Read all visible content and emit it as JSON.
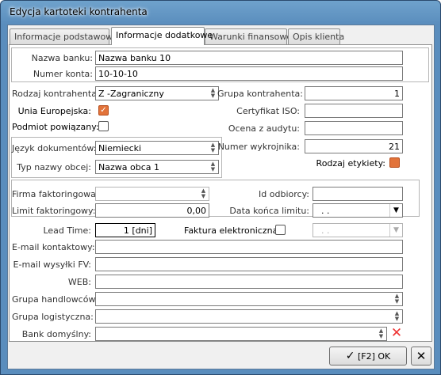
{
  "window": {
    "title": "Edycja kartoteki kontrahenta"
  },
  "tabs": [
    "Informacje podstawowe",
    "Informacje dodatkowe",
    "Warunki finansowe",
    "Opis klienta"
  ],
  "bank": {
    "name_label": "Nazwa banku:",
    "name_value": "Nazwa banku 10",
    "account_label": "Numer konta:",
    "account_value": "10-10-10"
  },
  "left": {
    "type_label": "Rodzaj kontrahenta:",
    "type_value": "Z -Zagraniczny",
    "eu_label": "Unia Europejska:",
    "eu_checked": true,
    "related_label": "Podmiot powiązany:",
    "related_checked": false,
    "doc_lang_label": "Język dokumentów:",
    "doc_lang_value": "Niemiecki",
    "foreign_name_label": "Typ nazwy obcej:",
    "foreign_name_value": "Nazwa obca 1"
  },
  "right": {
    "group_label": "Grupa kontrahenta:",
    "group_value": "1",
    "iso_label": "Certyfikat ISO:",
    "iso_value": "",
    "audit_label": "Ocena z audytu:",
    "audit_value": "",
    "pattern_label": "Numer wykrojnika:",
    "pattern_value": "21",
    "label_type_label": "Rodzaj etykiety:"
  },
  "factoring": {
    "firm_label": "Firma faktoringowa:",
    "firm_value": "",
    "limit_label": "Limit faktoringowy:",
    "limit_value": "0,00",
    "recipient_label": "Id odbiorcy:",
    "recipient_value": "",
    "limit_end_label": "Data końca limitu:",
    "limit_end_value": ". ."
  },
  "misc": {
    "lead_label": "Lead Time:",
    "lead_value": "1 [dni]",
    "einvoice_label": "Faktura elektroniczna:",
    "einvoice_value": ". .",
    "email_contact_label": "E-mail kontaktowy:",
    "email_contact_value": "",
    "email_fv_label": "E-mail wysyłki FV:",
    "email_fv_value": "",
    "web_label": "WEB:",
    "web_value": "",
    "trade_group_label": "Grupa handlowców:",
    "trade_group_value": "",
    "log_group_label": "Grupa logistyczna:",
    "log_group_value": "",
    "bank_default_label": "Bank domyślny:",
    "bank_default_value": ""
  },
  "buttons": {
    "ok_label": "[F2] OK"
  },
  "colors": {
    "accent": "#e2733a",
    "titlebar": "#5a8dbd"
  }
}
